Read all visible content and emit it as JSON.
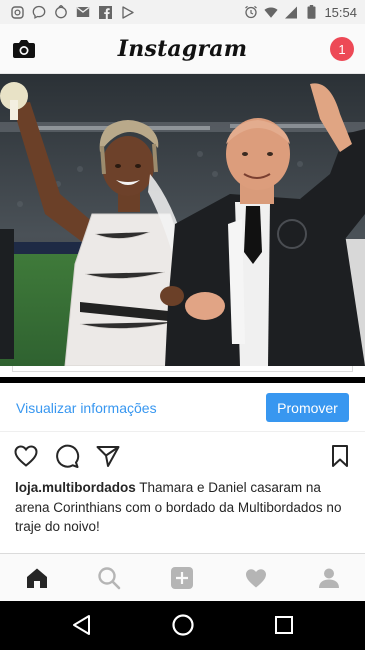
{
  "status_bar": {
    "time": "15:54",
    "left_icons": [
      "instagram-icon",
      "messenger-icon",
      "download-icon",
      "gmail-icon",
      "facebook-icon",
      "play-store-icon"
    ],
    "right_icons": [
      "alarm-icon",
      "wifi-icon",
      "signal-icon",
      "battery-icon"
    ]
  },
  "header": {
    "title": "Instagram",
    "notification_count": "1"
  },
  "promote": {
    "view_info_label": "Visualizar informações",
    "promote_label": "Promover"
  },
  "post": {
    "username": "loja.multibordados",
    "caption": "Thamara e Daniel casaram na arena Corinthians com o bordado da Multibordados no traje do noivo!"
  },
  "colors": {
    "link_blue": "#3897f0",
    "badge_red": "#ed4956"
  },
  "bottom_nav": [
    "home-icon",
    "search-icon",
    "add-icon",
    "heart-icon",
    "profile-icon"
  ],
  "android_nav": [
    "back-icon",
    "home-circle-icon",
    "recents-icon"
  ]
}
